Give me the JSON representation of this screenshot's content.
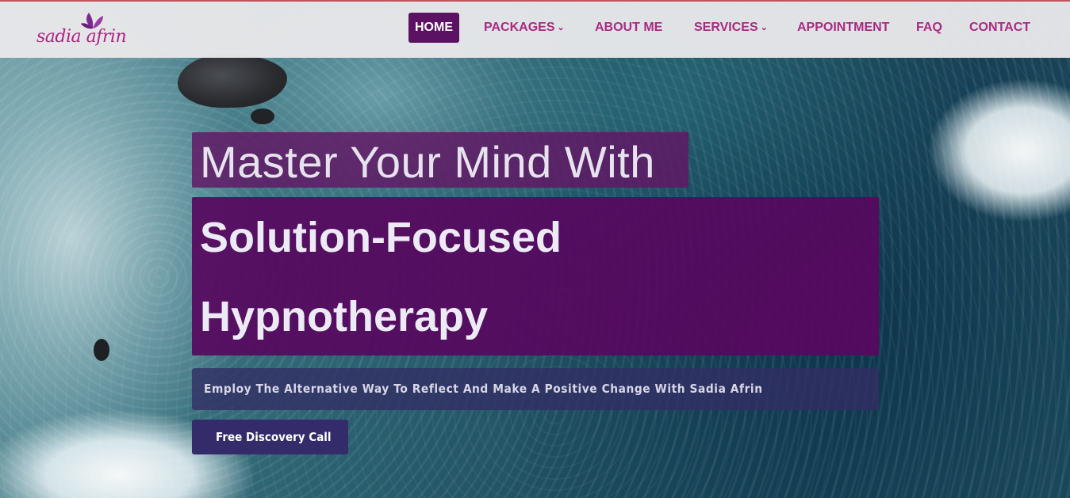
{
  "brand": {
    "logo_text": "sadia afrin",
    "accent_color": "#a92a83",
    "dark_purple": "#5b1262"
  },
  "nav": {
    "items": [
      {
        "label": "HOME",
        "active": true,
        "has_dropdown": false
      },
      {
        "label": "PACKAGES",
        "active": false,
        "has_dropdown": true
      },
      {
        "label": "ABOUT ME",
        "active": false,
        "has_dropdown": false
      },
      {
        "label": "SERVICES",
        "active": false,
        "has_dropdown": true
      },
      {
        "label": "APPOINTMENT",
        "active": false,
        "has_dropdown": false
      },
      {
        "label": "FAQ",
        "active": false,
        "has_dropdown": false
      },
      {
        "label": "CONTACT",
        "active": false,
        "has_dropdown": false
      }
    ],
    "dropdown_glyph": "⌄"
  },
  "hero": {
    "headline_line1": "Master Your Mind With",
    "headline_line2": "Solution-Focused",
    "headline_line3": "Hypnotherapy",
    "subtitle": "Employ The Alternative Way To Reflect And Make A Positive Change With Sadia Afrin",
    "cta_label": "Free Discovery Call"
  }
}
